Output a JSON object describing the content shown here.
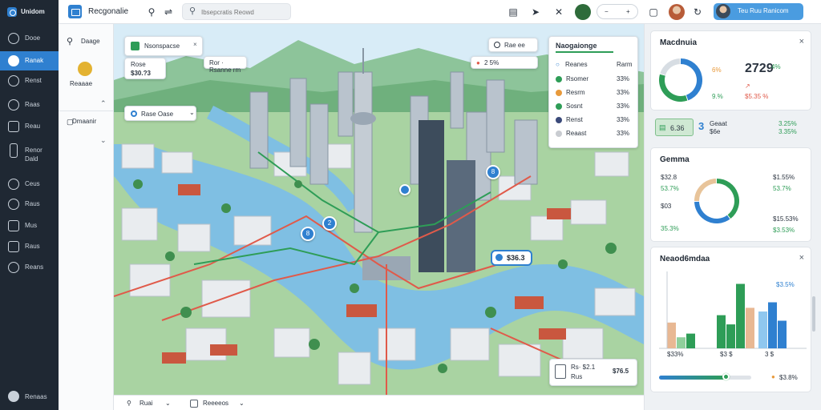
{
  "header": {
    "brand": "Unidom",
    "app_title": "Recgonalie",
    "search_placeholder": "Ibsepcratis Reowd",
    "zoom_minus": "−",
    "zoom_plus": "+",
    "user_label": "Teu Ruu Ranicom"
  },
  "sidebar": {
    "items": [
      {
        "label": "Dooe"
      },
      {
        "label": "Ranak"
      },
      {
        "label": "Renst"
      },
      {
        "label": "Raas"
      },
      {
        "label": "Reau"
      },
      {
        "label": "Renor",
        "label2": "Dald"
      },
      {
        "label": "Ceus"
      },
      {
        "label": "Raus"
      },
      {
        "label": "Mus"
      },
      {
        "label": "Raus"
      },
      {
        "label": "Reans"
      }
    ],
    "footer_label": "Renaas"
  },
  "layer_panel": {
    "search_label": "Daage",
    "layer_label": "Reaaae",
    "group_label": "Dmaanir"
  },
  "map": {
    "top_card": {
      "title": "Nsonspacse",
      "line1": "Rose",
      "line2": "Ror Is",
      "value": "$30.?3"
    },
    "route_card": {
      "label": "Ror · Rsanne rm"
    },
    "filter_dropdown": {
      "value": "Rase Oase"
    },
    "legend_card": {
      "title": "Naogaionge",
      "header_left": "Rae ee",
      "header_right": "2 5%",
      "toggle_left": "Reanes",
      "toggle_right": "Rarm",
      "rows": [
        {
          "label": "Rsomer",
          "value": "33%",
          "color": "#2e9d57"
        },
        {
          "label": "Resrm",
          "value": "33%",
          "color": "#e89a3c"
        },
        {
          "label": "Sosnt",
          "value": "33%",
          "color": "#2e9d57"
        },
        {
          "label": "Renst",
          "value": "33%",
          "color": "#3b4a7a"
        },
        {
          "label": "Reaast",
          "value": "33%",
          "color": "#c9ccd1"
        }
      ]
    },
    "pins": [
      {
        "label": "8"
      },
      {
        "label": "2"
      },
      {
        "label": "8"
      }
    ],
    "price_badge": "$36.3",
    "bottom_card": {
      "line1": "Rs· $2.1",
      "line2": "Rus",
      "value": "$76.5"
    }
  },
  "bottom_bar": {
    "item1": "Ruai",
    "item2": "Reeeeos"
  },
  "right_panel": {
    "card1": {
      "title": "Macdnuia",
      "ring_colors": [
        "#2f80d0",
        "#2e9d57",
        "#d7dde3"
      ],
      "ring_values": [
        45,
        35,
        20
      ],
      "pct_a": "6%",
      "pct_b": "9.%",
      "big_value": "2729",
      "up_value": "4%",
      "small_value": "$5.35 %"
    },
    "status_strip": {
      "left_value": "6.36",
      "mid_value": "3",
      "mid_label": "Geaat",
      "mid_sub": "$6e",
      "right_value1": "3.25%",
      "right_value2": "3.35%"
    },
    "card2": {
      "title": "Gemma",
      "ring_colors": [
        "#2e9d57",
        "#2f80d0",
        "#e8c49a"
      ],
      "ring_values": [
        40,
        35,
        25
      ],
      "left": [
        {
          "a": "$32.8",
          "b": "53.7%"
        },
        {
          "a": "$03",
          "b": "35.3%"
        }
      ],
      "right": [
        {
          "a": "$1.55%",
          "b": "53.7%"
        },
        {
          "a": "$15.53%",
          "b": "$3.53%"
        }
      ]
    },
    "card3": {
      "title": "Neaod6mdaa",
      "value_label": "$3.5%",
      "categories": [
        "$33%",
        "$3 $",
        "3 $"
      ],
      "bars": [
        {
          "group": 0,
          "value": 28,
          "color": "#e8b893"
        },
        {
          "group": 0,
          "value": 12,
          "color": "#8fcf9c"
        },
        {
          "group": 0,
          "value": 16,
          "color": "#2e9d57"
        },
        {
          "group": 1,
          "value": 36,
          "color": "#2e9d57"
        },
        {
          "group": 1,
          "value": 26,
          "color": "#2e9d57"
        },
        {
          "group": 1,
          "value": 70,
          "color": "#2e9d57"
        },
        {
          "group": 1,
          "value": 44,
          "color": "#e8b893"
        },
        {
          "group": 2,
          "value": 40,
          "color": "#8fc7ef"
        },
        {
          "group": 2,
          "value": 50,
          "color": "#2f80d0"
        },
        {
          "group": 2,
          "value": 30,
          "color": "#2f80d0"
        }
      ],
      "slider_fraction": 0.72,
      "slider_label": "$3.8%"
    }
  }
}
